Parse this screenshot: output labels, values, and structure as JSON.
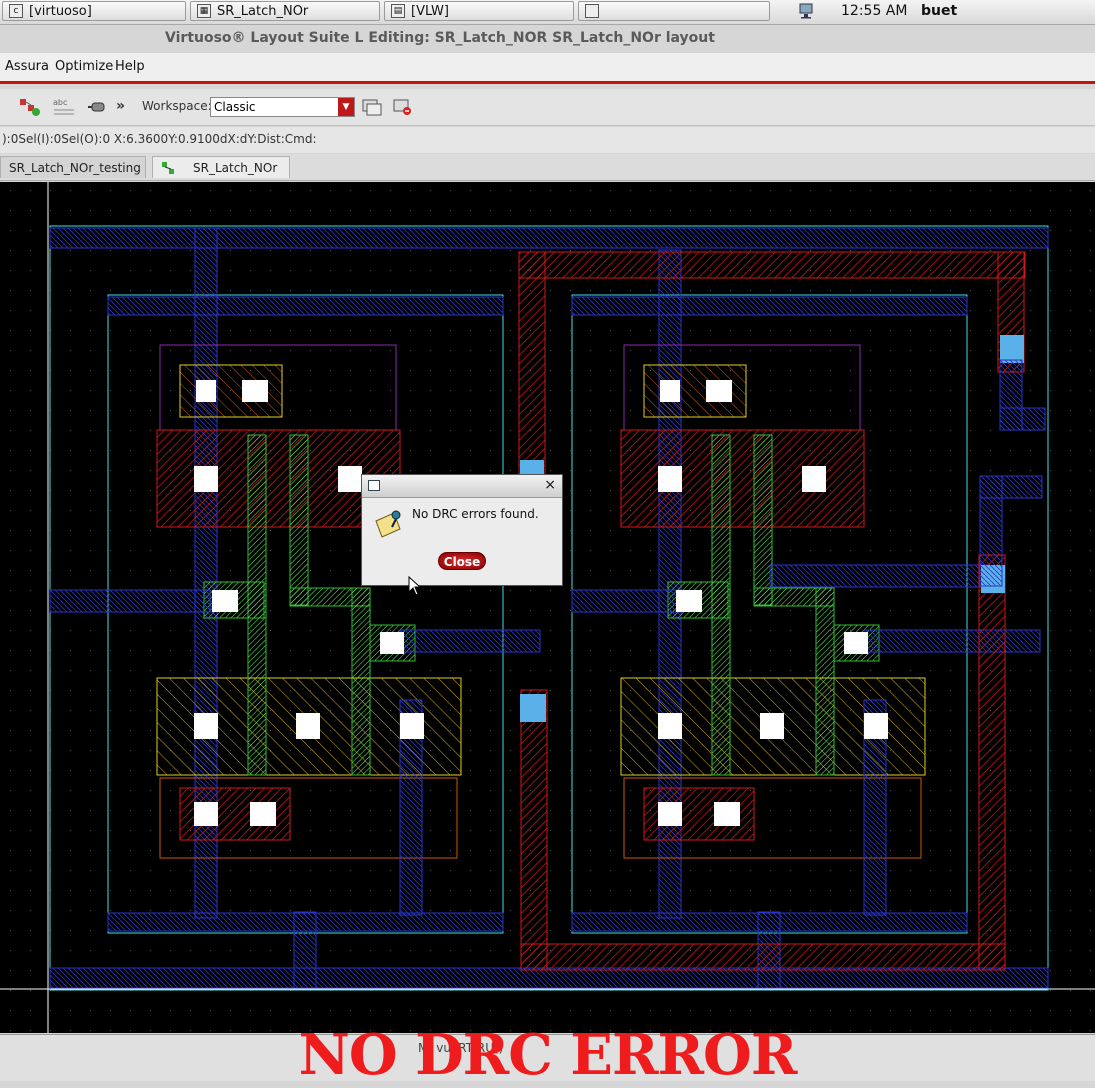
{
  "taskbar": {
    "tasks": [
      {
        "icon": "terminal-icon",
        "label": "[virtuoso]"
      },
      {
        "icon": "layout-window-icon",
        "label": "SR_Latch_NOr"
      },
      {
        "icon": "vlw-window-icon",
        "label": "[VLW]"
      },
      {
        "icon": "window-icon",
        "label": ""
      }
    ],
    "clock": "12:55 AM",
    "user": "buet"
  },
  "window": {
    "title": "Virtuoso® Layout Suite L Editing: SR_Latch_NOR SR_Latch_NOr layout"
  },
  "menu": {
    "items": [
      "Assura",
      "Optimize",
      "Help"
    ]
  },
  "toolbar": {
    "workspace_label": "Workspace:",
    "workspace_value": "Classic",
    "more": "»"
  },
  "status": {
    "text": "):0Sel(I):0Sel(O):0  X:6.3600Y:0.9100dX:dY:Dist:Cmd:"
  },
  "tabs": [
    {
      "label": "SR_Latch_NOr_testing"
    },
    {
      "label": "SR_Latch_NOr"
    }
  ],
  "dialog": {
    "message": "No DRC errors found.",
    "button": "Close",
    "close_glyph": "×"
  },
  "bottom": {
    "mouse_hint": "M: vuoRT RU()"
  },
  "overlay": {
    "text": "NO DRC ERROR"
  },
  "colors": {
    "metal1": "#2a35c8",
    "poly": "#2fbf2f",
    "nwell_outline": "#40e0e0",
    "metal2": "#d01818",
    "diffusion_outline": "#e0d020",
    "overlay": "#ee1c1c"
  }
}
